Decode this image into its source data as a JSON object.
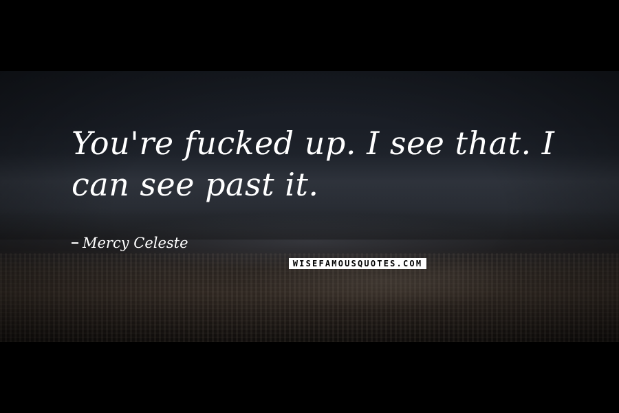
{
  "quote": {
    "text": "You're fucked up. I see that. I can see past it.",
    "author": "Mercy Celeste"
  },
  "watermark": {
    "text": "WISEFAMOUSQUOTES.COM"
  },
  "colors": {
    "background": "#000000",
    "text": "#ffffff"
  }
}
